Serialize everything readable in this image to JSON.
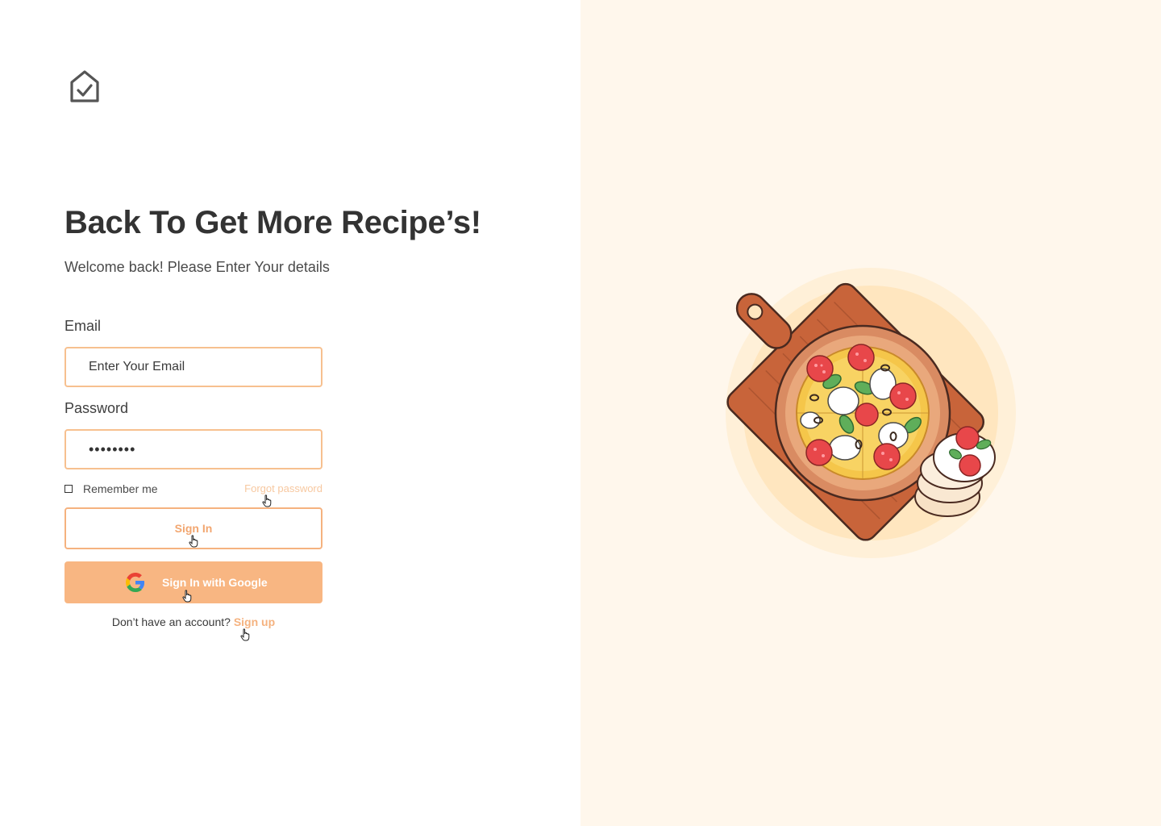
{
  "brand": {
    "logo_icon": "home-check-icon"
  },
  "header": {
    "title": "Back To Get More Recipe’s!",
    "subtitle": "Welcome back! Please Enter Your details"
  },
  "form": {
    "email_label": "Email",
    "email_placeholder": "Enter Your Email",
    "email_value": "",
    "password_label": "Password",
    "password_value": "••••••••",
    "remember_label": "Remember me",
    "remember_checked": false,
    "forgot_label": "Forgot password",
    "signin_label": "Sign In",
    "google_label": "Sign In with Google",
    "google_icon": "google-icon",
    "signup_prompt": "Don’t have an account?",
    "signup_label": "Sign up"
  },
  "illustration": {
    "subject": "pizza-board-illustration"
  },
  "colors": {
    "accent": "#f8b682",
    "accent_border": "#f5b27f",
    "forgot_link": "#f7c8a0",
    "right_panel_bg": "#fff7ec",
    "heading_text": "#333333"
  }
}
